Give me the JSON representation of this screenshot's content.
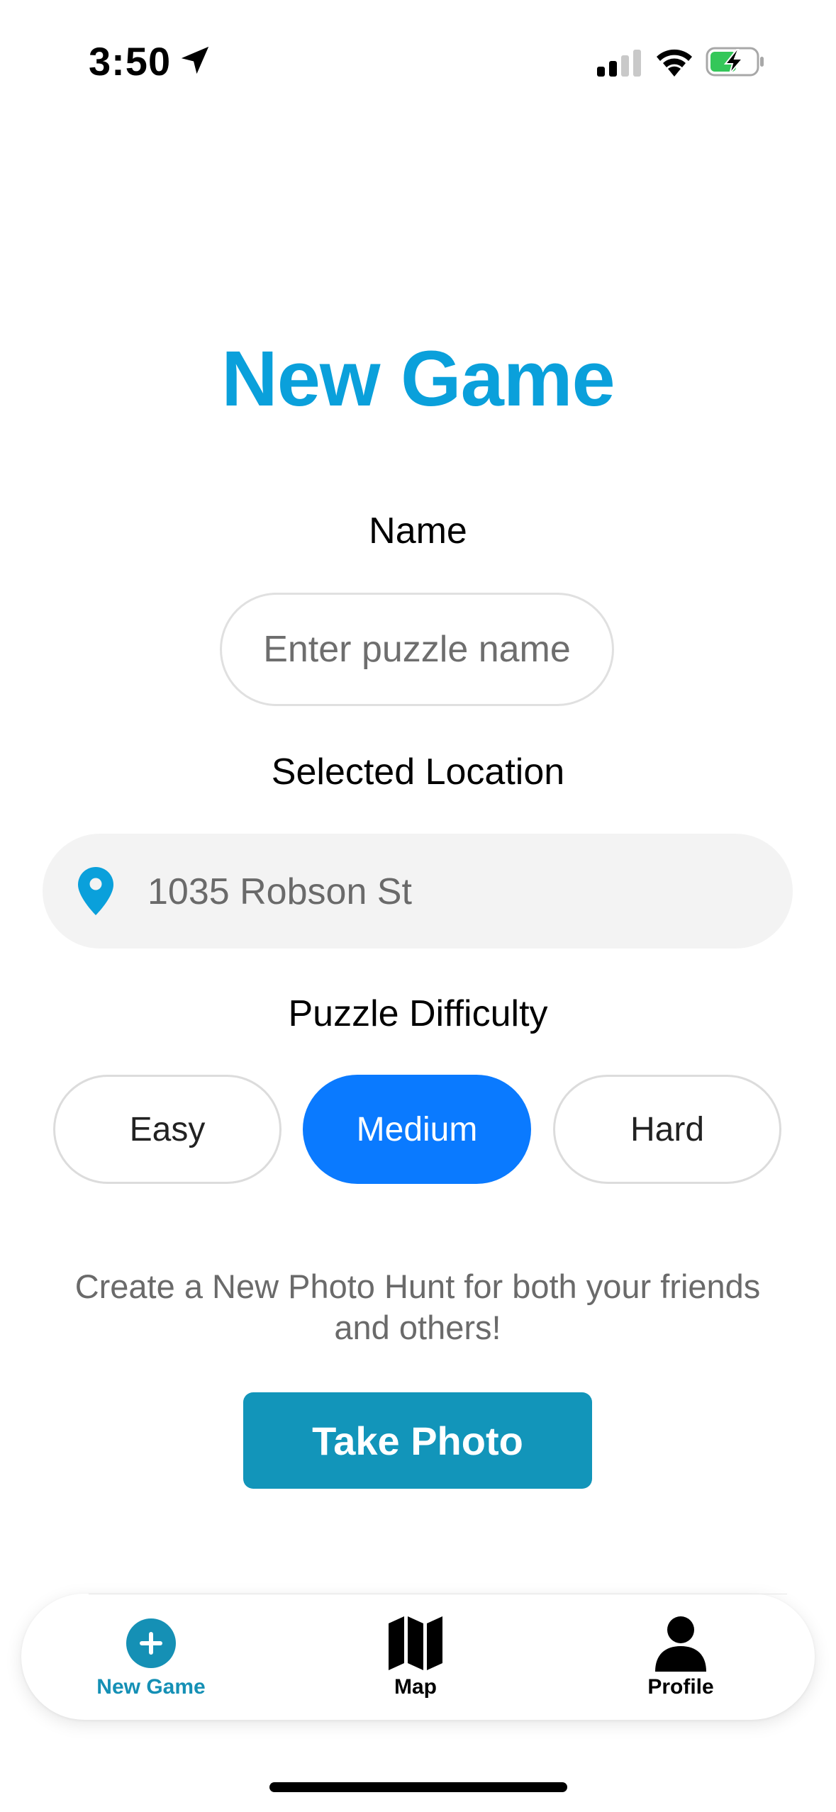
{
  "status_bar": {
    "time": "3:50",
    "icons": [
      "location-arrow-icon",
      "cellular-signal-icon",
      "wifi-icon",
      "battery-charging-icon"
    ]
  },
  "page": {
    "title": "New Game",
    "title_color": "#0aa0db"
  },
  "name_field": {
    "label": "Name",
    "placeholder": "Enter puzzle name",
    "value": ""
  },
  "location_field": {
    "label": "Selected Location",
    "icon": "map-pin-icon",
    "value": "1035 Robson St"
  },
  "difficulty": {
    "label": "Puzzle Difficulty",
    "options": [
      "Easy",
      "Medium",
      "Hard"
    ],
    "selected": "Medium",
    "selected_color": "#0a7aff"
  },
  "description": "Create a New Photo Hunt for both your friends and others!",
  "take_photo": {
    "label": "Take Photo",
    "color": "#1295ba"
  },
  "tab_bar": {
    "items": [
      {
        "label": "New Game",
        "icon": "plus-circle-icon",
        "active": true
      },
      {
        "label": "Map",
        "icon": "map-icon",
        "active": false
      },
      {
        "label": "Profile",
        "icon": "person-icon",
        "active": false
      }
    ],
    "active_color": "#1590b5"
  }
}
